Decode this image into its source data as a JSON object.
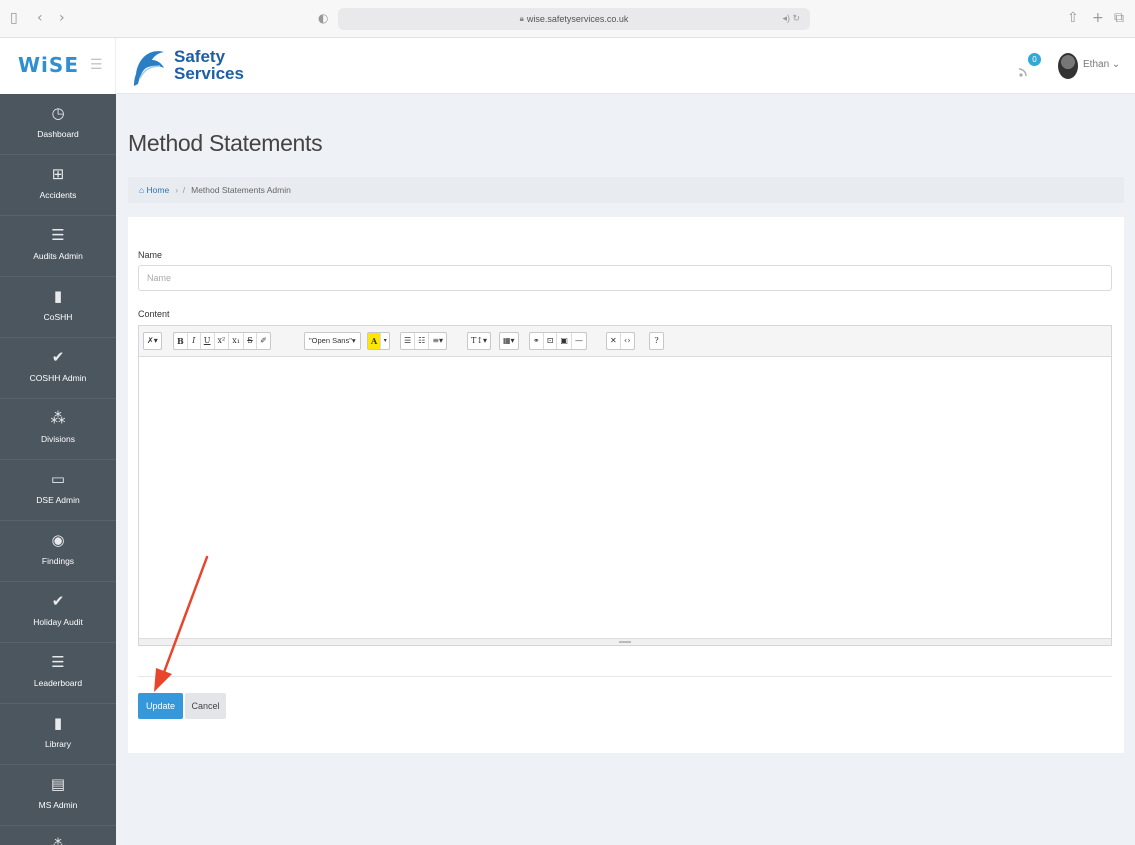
{
  "browser": {
    "url": "wise.safetyservices.co.uk",
    "icons": [
      "sidebar-toggle-icon",
      "back-icon",
      "forward-icon",
      "shield-icon",
      "share-icon",
      "new-tab-icon",
      "tabs-icon"
    ]
  },
  "header": {
    "app_logo": "WiSE",
    "brand_line1": "Safety",
    "brand_line2": "Services",
    "notification_count": "0",
    "user_name": "Ethan"
  },
  "sidebar": {
    "items": [
      {
        "label": "Dashboard",
        "icon": "dashboard-icon"
      },
      {
        "label": "Accidents",
        "icon": "first-aid-icon"
      },
      {
        "label": "Audits Admin",
        "icon": "list-icon"
      },
      {
        "label": "CoSHH",
        "icon": "book-icon"
      },
      {
        "label": "COSHH Admin",
        "icon": "check-icon"
      },
      {
        "label": "Divisions",
        "icon": "users-icon"
      },
      {
        "label": "DSE Admin",
        "icon": "monitor-icon"
      },
      {
        "label": "Findings",
        "icon": "eye-icon"
      },
      {
        "label": "Holiday Audit",
        "icon": "check-icon"
      },
      {
        "label": "Leaderboard",
        "icon": "list-icon"
      },
      {
        "label": "Library",
        "icon": "book-icon"
      },
      {
        "label": "MS Admin",
        "icon": "document-icon"
      },
      {
        "label": "",
        "icon": "users-icon"
      }
    ]
  },
  "main": {
    "title": "Method Statements",
    "breadcrumb": {
      "home": "Home",
      "current": "Method Statements Admin"
    },
    "form": {
      "name_label": "Name",
      "name_placeholder": "Name",
      "name_value": "",
      "content_label": "Content",
      "toolbar": {
        "style": "✗▾",
        "bold": "B",
        "italic": "I",
        "underline": "U",
        "superscript": "x²",
        "subscript": "x₁",
        "strikethrough": "S",
        "clear": "✐",
        "font_name": "\"Open Sans\"▾",
        "highlight": "A",
        "highlight_caret": "▾",
        "ul": "☰",
        "ol": "☷",
        "align": "≡▾",
        "height": "T↕▾",
        "table": "▦▾",
        "link": "⚭",
        "picture": "⊡",
        "video": "▣",
        "hr": "—",
        "fullscreen": "✕",
        "code": "‹›",
        "help": "?"
      },
      "update_label": "Update",
      "cancel_label": "Cancel"
    }
  },
  "colors": {
    "sidebar_bg": "#4b565f",
    "primary_button": "#3498db",
    "annotation_arrow": "#e8452c"
  }
}
